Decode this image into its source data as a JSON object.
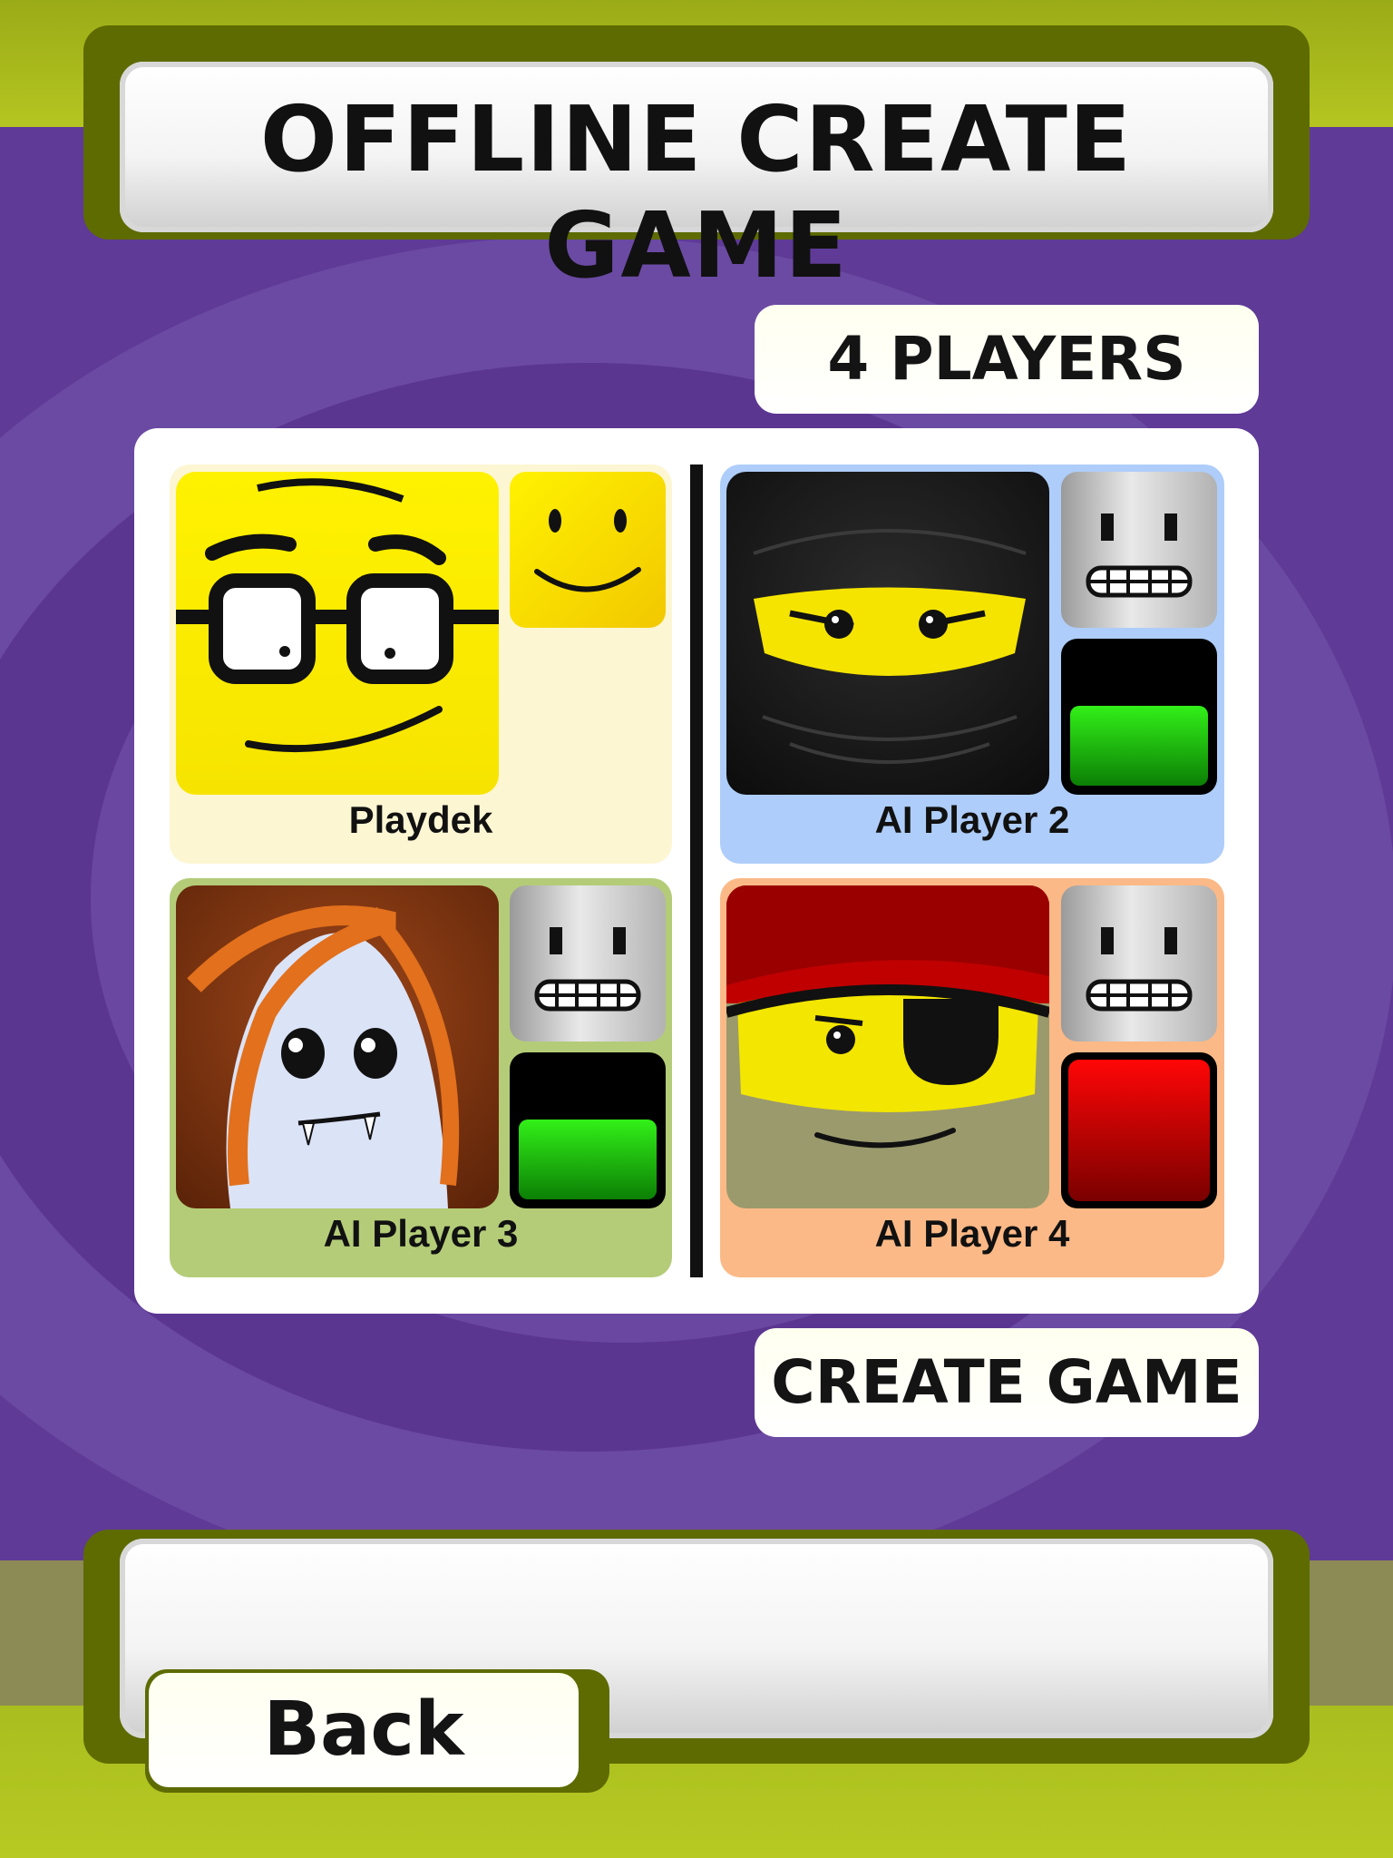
{
  "screen": {
    "title": "OFFLINE CREATE GAME",
    "player_count_label": "4 PLAYERS",
    "create_button_label": "CREATE GAME",
    "back_button_label": "Back"
  },
  "players": [
    {
      "name": "Playdek",
      "avatar": "nerd-glasses-avatar",
      "type_icon": "smiley-face-icon",
      "card_color": "#fdf6d3"
    },
    {
      "name": "AI Player 2",
      "avatar": "ninja-avatar",
      "type_icon": "robot-icon",
      "status": "green",
      "card_color": "#aecdfa"
    },
    {
      "name": "AI Player 3",
      "avatar": "ghost-girl-avatar",
      "type_icon": "robot-icon",
      "status": "green",
      "card_color": "#b4cc78"
    },
    {
      "name": "AI Player 4",
      "avatar": "pirate-avatar",
      "type_icon": "robot-icon",
      "status": "red",
      "card_color": "#fbb987"
    }
  ],
  "colors": {
    "background_purple": "#5f3a96",
    "frame_olive": "#5e6b00",
    "status_green": "#19c40a",
    "status_red": "#d80000"
  }
}
